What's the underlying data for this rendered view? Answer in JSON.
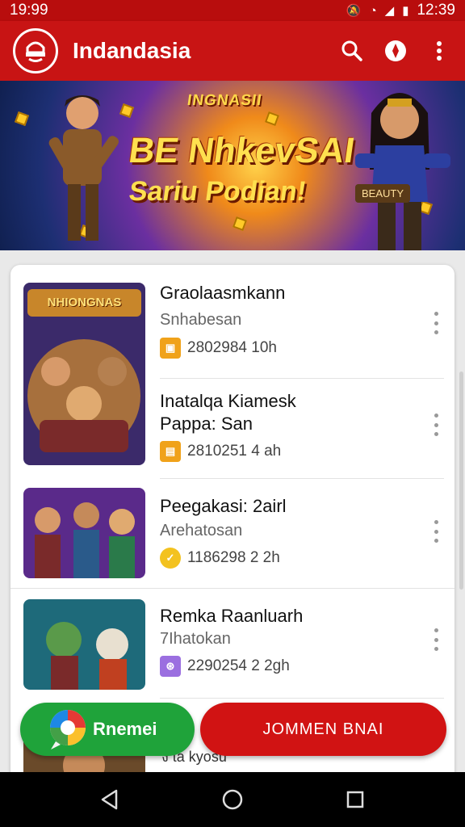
{
  "status_bar": {
    "time_left": "19:99",
    "time_right": "12:39"
  },
  "app_bar": {
    "title": "Indandasia"
  },
  "banner": {
    "line1": "INGNASII",
    "line2": "BE NhkevSAI",
    "line3": "Sariu Podian!",
    "tag": "BEAUTY"
  },
  "list": [
    {
      "thumb_label": "NHIONGNAS",
      "title": "Graolaasmkann",
      "subtitle": "Snhabesan",
      "meta": "2802984 10h",
      "meta_color": "#f0a21a",
      "meta_icon": "▣"
    },
    {
      "thumb_label": "",
      "title": "Inatalqa Kiamesk",
      "title2": "Pappa: San",
      "subtitle": "",
      "meta": "2810251 4 ah",
      "meta_color": "#f0a21a",
      "meta_icon": "▤"
    },
    {
      "thumb_label": "",
      "title": "Peegakasi: 2airl",
      "subtitle": "Arehatosan",
      "meta": "1186298 2 2h",
      "meta_color": "#f3c21f",
      "meta_icon": "✓"
    },
    {
      "thumb_label": "",
      "title": "Remka Raanluarh",
      "subtitle": "7Ihatokan",
      "meta": "2290254 2 2gh",
      "meta_color": "#9b6fe0",
      "meta_icon": "⊛"
    }
  ],
  "peek_text": "ง ta kyosu",
  "buttons": {
    "green_label": "Rnemei",
    "red_label": "JOMMEN BNAI"
  },
  "colors": {
    "primary": "#c81414",
    "accent_green": "#1fa33a"
  }
}
